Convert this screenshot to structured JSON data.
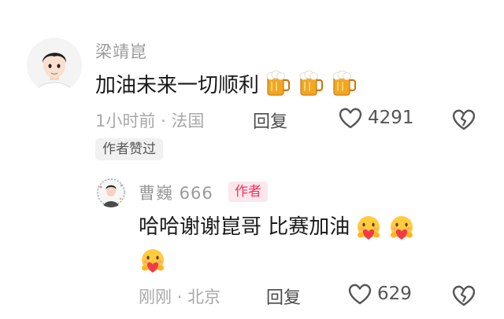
{
  "comment": {
    "username": "梁靖崑",
    "text": "加油未来一切顺利",
    "emoji_icons": [
      "beer-mug-icon",
      "beer-mug-icon",
      "beer-mug-icon"
    ],
    "time_location": "1小时前 · 法国",
    "reply_label": "回复",
    "like_count": "4291",
    "author_liked_badge": "作者赞过"
  },
  "reply": {
    "username": "曹巍 666",
    "author_tag": "作者",
    "text": "哈哈谢谢崑哥 比赛加油",
    "emoji_icons": [
      "hugging-face-icon",
      "hugging-face-icon",
      "hugging-face-icon"
    ],
    "time_location": "刚刚 · 北京",
    "reply_label": "回复",
    "like_count": "629"
  },
  "colors": {
    "like_heart_outline": "#666666",
    "author_tag_text": "#f0335a",
    "author_tag_bg": "#fde7ec",
    "meta_text": "#a8a8a8"
  }
}
